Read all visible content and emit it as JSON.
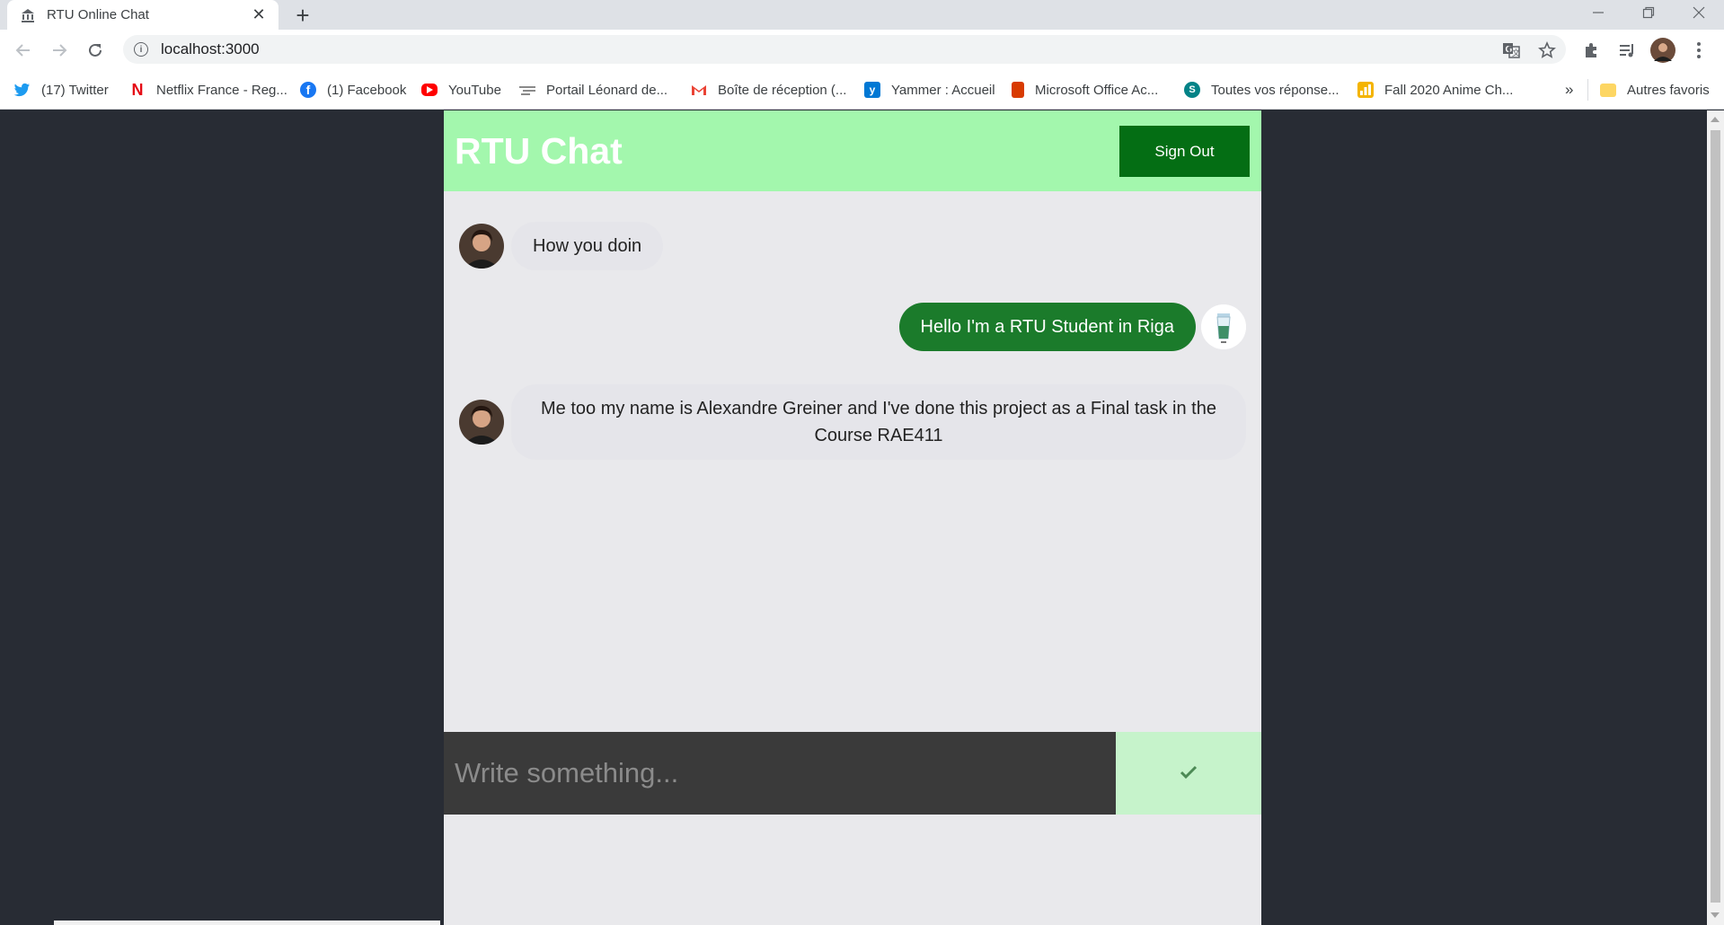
{
  "browser": {
    "tab_title": "RTU Online Chat",
    "url": "localhost:3000",
    "bookmarks": [
      {
        "label": "(17) Twitter",
        "icon": "twitter-icon"
      },
      {
        "label": "Netflix France - Reg...",
        "icon": "netflix-icon"
      },
      {
        "label": "(1) Facebook",
        "icon": "facebook-icon"
      },
      {
        "label": "YouTube",
        "icon": "youtube-icon"
      },
      {
        "label": "Portail Léonard de...",
        "icon": "portal-icon"
      },
      {
        "label": "Boîte de réception (...",
        "icon": "gmail-icon"
      },
      {
        "label": "Yammer : Accueil",
        "icon": "yammer-icon"
      },
      {
        "label": "Microsoft Office Ac...",
        "icon": "office-icon"
      },
      {
        "label": "Toutes vos réponse...",
        "icon": "sharepoint-icon"
      },
      {
        "label": "Fall 2020 Anime Ch...",
        "icon": "anime-chart-icon"
      }
    ],
    "more_bookmarks": "»",
    "other_bookmarks": "Autres favoris"
  },
  "chat": {
    "title": "RTU Chat",
    "signout_label": "Sign Out",
    "messages": [
      {
        "type": "received",
        "text": "How you doin"
      },
      {
        "type": "sent",
        "text": "Hello I'm a RTU Student in Riga"
      },
      {
        "type": "received",
        "text": "Me too my name is Alexandre Greiner and I've done this project as a Final task in the Course RAE411"
      }
    ],
    "input_placeholder": "Write something...",
    "send_icon": "check-icon"
  },
  "colors": {
    "header": "#a3f7ad",
    "signout": "#046e14",
    "sent_bubble": "#1b7b2b",
    "received_bubble": "#e5e5ea",
    "send_button": "#c6f3cb",
    "page_background": "#282c34"
  }
}
